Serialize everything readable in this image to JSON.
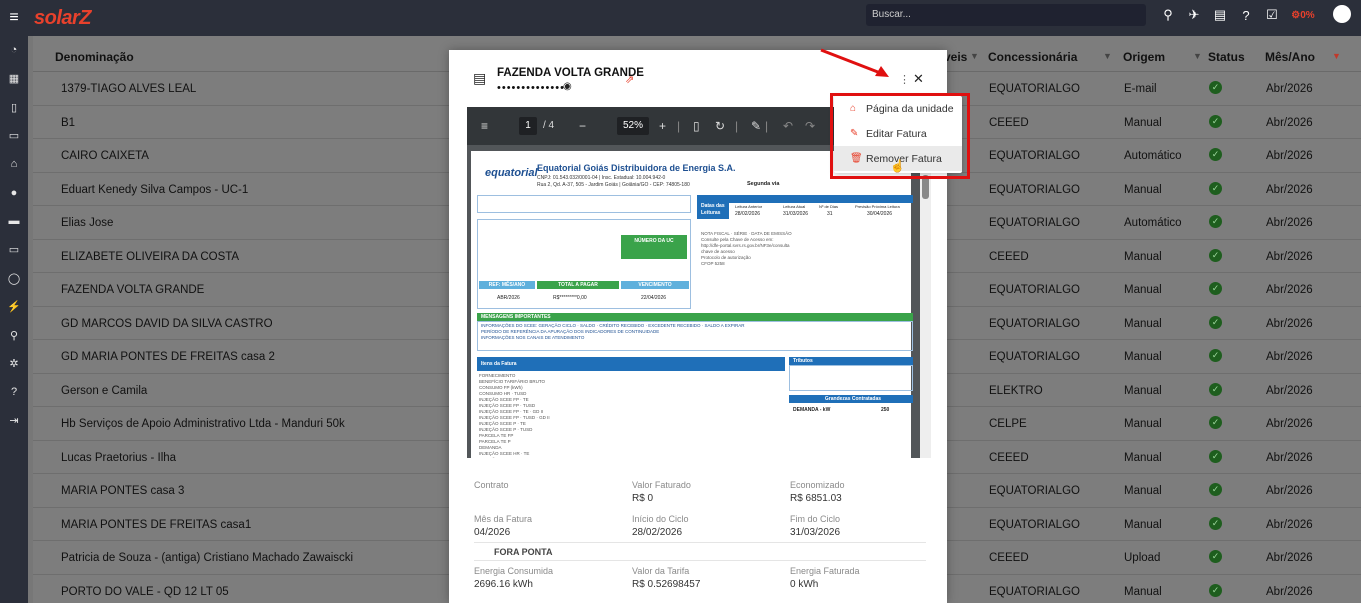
{
  "app": {
    "brand": "solarZ",
    "search_placeholder": "Buscar...",
    "percent_badge": "0%"
  },
  "table": {
    "headers": {
      "denominacao": "Denominação",
      "veis": "veis",
      "concessionaria": "Concessionária",
      "origem": "Origem",
      "status": "Status",
      "mes_ano": "Mês/Ano"
    },
    "rows": [
      {
        "name": "1379-TIAGO ALVES LEAL",
        "concessionaria": "EQUATORIALGO",
        "origem": "E-mail",
        "mes": "Abr/2026"
      },
      {
        "name": "B1",
        "concessionaria": "CEEED",
        "origem": "Manual",
        "mes": "Abr/2026"
      },
      {
        "name": "CAIRO CAIXETA",
        "concessionaria": "EQUATORIALGO",
        "origem": "Automático",
        "mes": "Abr/2026"
      },
      {
        "name": "Eduart Kenedy Silva Campos - UC-1",
        "concessionaria": "EQUATORIALGO",
        "origem": "Manual",
        "mes": "Abr/2026"
      },
      {
        "name": "Elias Jose",
        "concessionaria": "EQUATORIALGO",
        "origem": "Automático",
        "mes": "Abr/2026"
      },
      {
        "name": "ELIZABETE OLIVEIRA DA COSTA",
        "concessionaria": "CEEED",
        "origem": "Manual",
        "mes": "Abr/2026"
      },
      {
        "name": "FAZENDA VOLTA GRANDE",
        "concessionaria": "EQUATORIALGO",
        "origem": "Manual",
        "mes": "Abr/2026"
      },
      {
        "name": "GD MARCOS DAVID DA SILVA CASTRO",
        "concessionaria": "EQUATORIALGO",
        "origem": "Manual",
        "mes": "Abr/2026"
      },
      {
        "name": "GD MARIA PONTES DE FREITAS casa 2",
        "concessionaria": "EQUATORIALGO",
        "origem": "Manual",
        "mes": "Abr/2026"
      },
      {
        "name": "Gerson e Camila",
        "concessionaria": "ELEKTRO",
        "origem": "Manual",
        "mes": "Abr/2026"
      },
      {
        "name": "Hb Serviços de Apoio Administrativo Ltda - Manduri 50k",
        "concessionaria": "CELPE",
        "origem": "Manual",
        "mes": "Abr/2026"
      },
      {
        "name": "Lucas Praetorius - Ilha",
        "concessionaria": "CEEED",
        "origem": "Manual",
        "mes": "Abr/2026"
      },
      {
        "name": "MARIA PONTES casa 3",
        "concessionaria": "EQUATORIALGO",
        "origem": "Manual",
        "mes": "Abr/2026"
      },
      {
        "name": "MARIA PONTES DE FREITAS casa1",
        "concessionaria": "EQUATORIALGO",
        "origem": "Manual",
        "mes": "Abr/2026"
      },
      {
        "name": "Patricia de Souza - (antiga) Cristiano Machado Zawaiscki",
        "concessionaria": "CEEED",
        "origem": "Upload",
        "mes": "Abr/2026"
      },
      {
        "name": "PORTO DO VALE - QD 12 LT 05",
        "concessionaria": "EQUATORIALGO",
        "origem": "Manual",
        "mes": "Abr/2026"
      }
    ]
  },
  "modal": {
    "title": "FAZENDA VOLTA GRANDE",
    "subtitle": "•••••••••••••••",
    "pdf": {
      "page": "1",
      "pages": "/ 4",
      "zoom": "52%"
    },
    "bill": {
      "logo": "equatorial",
      "company": "Equatorial Goiás Distribuidora de Energia S.A.",
      "cnpj": "CNPJ: 01.543.032/0001-04 | Insc. Estadual: 10.004.942-0",
      "address": "Rua 2, Qd. A-37, 505 - Jardim Goiás | Goiânia/GO - CEP: 74805-180",
      "segunda_via": "Segunda via",
      "datas_leituras": "Datas das Leituras",
      "leitura_anterior_label": "Leitura Anterior",
      "leitura_anterior": "28/02/2026",
      "leitura_atual_label": "Leitura Atual",
      "leitura_atual": "31/03/2026",
      "n_dias_label": "Nº de Dias",
      "n_dias": "31",
      "proxima_label": "Previsão Próxima Leitura",
      "proxima": "30/04/2026",
      "numero_uc": "NÚMERO DA UC",
      "ref_mes_ano": "REF: MÊS/ANO",
      "ref_value": "ABR/2026",
      "total_pagar": "TOTAL A PAGAR",
      "total_value": "R$*********0,00",
      "vencimento": "VENCIMENTO",
      "vencimento_value": "22/04/2026",
      "mensagens": "MENSAGENS IMPORTANTES",
      "tributos": "Tributos",
      "grandezas": "Grandezas Contratadas",
      "demanda": "DEMANDA - kW",
      "demanda_value": "250",
      "itens_fatura": "Itens da Fatura"
    },
    "details": {
      "contrato_label": "Contrato",
      "valor_faturado_label": "Valor Faturado",
      "valor_faturado": "R$ 0",
      "economizado_label": "Economizado",
      "economizado": "R$ 6851.03",
      "mes_fatura_label": "Mês da Fatura",
      "mes_fatura": "04/2026",
      "inicio_ciclo_label": "Início do Ciclo",
      "inicio_ciclo": "28/02/2026",
      "fim_ciclo_label": "Fim do Ciclo",
      "fim_ciclo": "31/03/2026",
      "fora_ponta": "FORA PONTA",
      "energia_consumida_label": "Energia Consumida",
      "energia_consumida": "2696.16 kWh",
      "valor_tarifa_label": "Valor da Tarifa",
      "valor_tarifa": "R$ 0.52698457",
      "energia_faturada_label": "Energia Faturada",
      "energia_faturada": "0 kWh"
    }
  },
  "menu": {
    "items": [
      {
        "label": "Página da unidade",
        "icon": "home-icon"
      },
      {
        "label": "Editar Fatura",
        "icon": "edit-icon"
      },
      {
        "label": "Remover Fatura",
        "icon": "trash-icon"
      }
    ]
  },
  "colors": {
    "accent": "#e8412c",
    "topbar": "#2b2f3a",
    "status_ok": "#1e5e1e",
    "annotation": "#e01010"
  }
}
